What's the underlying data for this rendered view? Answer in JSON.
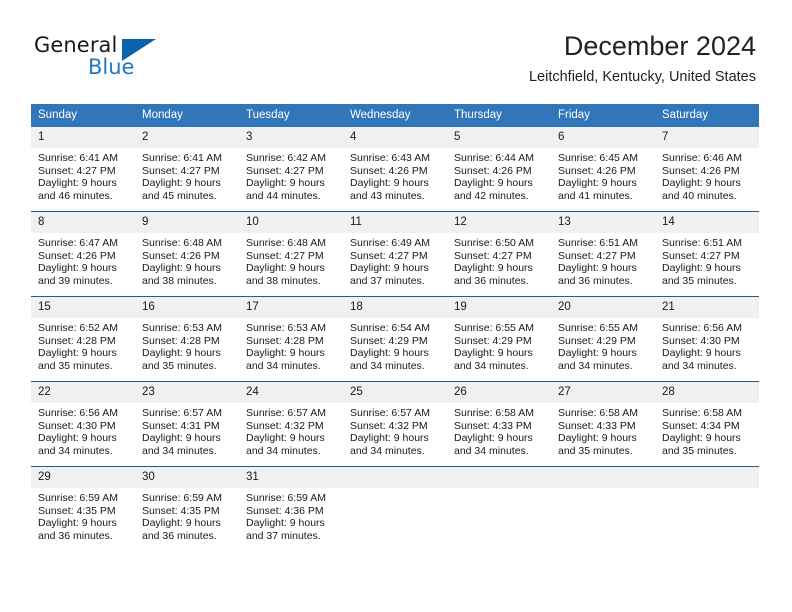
{
  "brand": {
    "name_top": "General",
    "name_bottom": "Blue",
    "accent_color": "#1f7ac4",
    "triangle_color": "#0c63ad"
  },
  "header": {
    "title": "December 2024",
    "subtitle": "Leitchfield, Kentucky, United States"
  },
  "theme": {
    "header_row_bg": "#3276ba",
    "daynum_bg": "#f0f0f0",
    "row_divider": "#1b5d9e",
    "text": "#1a1a1a"
  },
  "calendar": {
    "weekday_headers": [
      "Sunday",
      "Monday",
      "Tuesday",
      "Wednesday",
      "Thursday",
      "Friday",
      "Saturday"
    ],
    "weeks": [
      [
        {
          "day": "1",
          "sunrise": "Sunrise: 6:41 AM",
          "sunset": "Sunset: 4:27 PM",
          "daylight1": "Daylight: 9 hours",
          "daylight2": "and 46 minutes."
        },
        {
          "day": "2",
          "sunrise": "Sunrise: 6:41 AM",
          "sunset": "Sunset: 4:27 PM",
          "daylight1": "Daylight: 9 hours",
          "daylight2": "and 45 minutes."
        },
        {
          "day": "3",
          "sunrise": "Sunrise: 6:42 AM",
          "sunset": "Sunset: 4:27 PM",
          "daylight1": "Daylight: 9 hours",
          "daylight2": "and 44 minutes."
        },
        {
          "day": "4",
          "sunrise": "Sunrise: 6:43 AM",
          "sunset": "Sunset: 4:26 PM",
          "daylight1": "Daylight: 9 hours",
          "daylight2": "and 43 minutes."
        },
        {
          "day": "5",
          "sunrise": "Sunrise: 6:44 AM",
          "sunset": "Sunset: 4:26 PM",
          "daylight1": "Daylight: 9 hours",
          "daylight2": "and 42 minutes."
        },
        {
          "day": "6",
          "sunrise": "Sunrise: 6:45 AM",
          "sunset": "Sunset: 4:26 PM",
          "daylight1": "Daylight: 9 hours",
          "daylight2": "and 41 minutes."
        },
        {
          "day": "7",
          "sunrise": "Sunrise: 6:46 AM",
          "sunset": "Sunset: 4:26 PM",
          "daylight1": "Daylight: 9 hours",
          "daylight2": "and 40 minutes."
        }
      ],
      [
        {
          "day": "8",
          "sunrise": "Sunrise: 6:47 AM",
          "sunset": "Sunset: 4:26 PM",
          "daylight1": "Daylight: 9 hours",
          "daylight2": "and 39 minutes."
        },
        {
          "day": "9",
          "sunrise": "Sunrise: 6:48 AM",
          "sunset": "Sunset: 4:26 PM",
          "daylight1": "Daylight: 9 hours",
          "daylight2": "and 38 minutes."
        },
        {
          "day": "10",
          "sunrise": "Sunrise: 6:48 AM",
          "sunset": "Sunset: 4:27 PM",
          "daylight1": "Daylight: 9 hours",
          "daylight2": "and 38 minutes."
        },
        {
          "day": "11",
          "sunrise": "Sunrise: 6:49 AM",
          "sunset": "Sunset: 4:27 PM",
          "daylight1": "Daylight: 9 hours",
          "daylight2": "and 37 minutes."
        },
        {
          "day": "12",
          "sunrise": "Sunrise: 6:50 AM",
          "sunset": "Sunset: 4:27 PM",
          "daylight1": "Daylight: 9 hours",
          "daylight2": "and 36 minutes."
        },
        {
          "day": "13",
          "sunrise": "Sunrise: 6:51 AM",
          "sunset": "Sunset: 4:27 PM",
          "daylight1": "Daylight: 9 hours",
          "daylight2": "and 36 minutes."
        },
        {
          "day": "14",
          "sunrise": "Sunrise: 6:51 AM",
          "sunset": "Sunset: 4:27 PM",
          "daylight1": "Daylight: 9 hours",
          "daylight2": "and 35 minutes."
        }
      ],
      [
        {
          "day": "15",
          "sunrise": "Sunrise: 6:52 AM",
          "sunset": "Sunset: 4:28 PM",
          "daylight1": "Daylight: 9 hours",
          "daylight2": "and 35 minutes."
        },
        {
          "day": "16",
          "sunrise": "Sunrise: 6:53 AM",
          "sunset": "Sunset: 4:28 PM",
          "daylight1": "Daylight: 9 hours",
          "daylight2": "and 35 minutes."
        },
        {
          "day": "17",
          "sunrise": "Sunrise: 6:53 AM",
          "sunset": "Sunset: 4:28 PM",
          "daylight1": "Daylight: 9 hours",
          "daylight2": "and 34 minutes."
        },
        {
          "day": "18",
          "sunrise": "Sunrise: 6:54 AM",
          "sunset": "Sunset: 4:29 PM",
          "daylight1": "Daylight: 9 hours",
          "daylight2": "and 34 minutes."
        },
        {
          "day": "19",
          "sunrise": "Sunrise: 6:55 AM",
          "sunset": "Sunset: 4:29 PM",
          "daylight1": "Daylight: 9 hours",
          "daylight2": "and 34 minutes."
        },
        {
          "day": "20",
          "sunrise": "Sunrise: 6:55 AM",
          "sunset": "Sunset: 4:29 PM",
          "daylight1": "Daylight: 9 hours",
          "daylight2": "and 34 minutes."
        },
        {
          "day": "21",
          "sunrise": "Sunrise: 6:56 AM",
          "sunset": "Sunset: 4:30 PM",
          "daylight1": "Daylight: 9 hours",
          "daylight2": "and 34 minutes."
        }
      ],
      [
        {
          "day": "22",
          "sunrise": "Sunrise: 6:56 AM",
          "sunset": "Sunset: 4:30 PM",
          "daylight1": "Daylight: 9 hours",
          "daylight2": "and 34 minutes."
        },
        {
          "day": "23",
          "sunrise": "Sunrise: 6:57 AM",
          "sunset": "Sunset: 4:31 PM",
          "daylight1": "Daylight: 9 hours",
          "daylight2": "and 34 minutes."
        },
        {
          "day": "24",
          "sunrise": "Sunrise: 6:57 AM",
          "sunset": "Sunset: 4:32 PM",
          "daylight1": "Daylight: 9 hours",
          "daylight2": "and 34 minutes."
        },
        {
          "day": "25",
          "sunrise": "Sunrise: 6:57 AM",
          "sunset": "Sunset: 4:32 PM",
          "daylight1": "Daylight: 9 hours",
          "daylight2": "and 34 minutes."
        },
        {
          "day": "26",
          "sunrise": "Sunrise: 6:58 AM",
          "sunset": "Sunset: 4:33 PM",
          "daylight1": "Daylight: 9 hours",
          "daylight2": "and 34 minutes."
        },
        {
          "day": "27",
          "sunrise": "Sunrise: 6:58 AM",
          "sunset": "Sunset: 4:33 PM",
          "daylight1": "Daylight: 9 hours",
          "daylight2": "and 35 minutes."
        },
        {
          "day": "28",
          "sunrise": "Sunrise: 6:58 AM",
          "sunset": "Sunset: 4:34 PM",
          "daylight1": "Daylight: 9 hours",
          "daylight2": "and 35 minutes."
        }
      ],
      [
        {
          "day": "29",
          "sunrise": "Sunrise: 6:59 AM",
          "sunset": "Sunset: 4:35 PM",
          "daylight1": "Daylight: 9 hours",
          "daylight2": "and 36 minutes."
        },
        {
          "day": "30",
          "sunrise": "Sunrise: 6:59 AM",
          "sunset": "Sunset: 4:35 PM",
          "daylight1": "Daylight: 9 hours",
          "daylight2": "and 36 minutes."
        },
        {
          "day": "31",
          "sunrise": "Sunrise: 6:59 AM",
          "sunset": "Sunset: 4:36 PM",
          "daylight1": "Daylight: 9 hours",
          "daylight2": "and 37 minutes."
        },
        {
          "day": "",
          "sunrise": "",
          "sunset": "",
          "daylight1": "",
          "daylight2": ""
        },
        {
          "day": "",
          "sunrise": "",
          "sunset": "",
          "daylight1": "",
          "daylight2": ""
        },
        {
          "day": "",
          "sunrise": "",
          "sunset": "",
          "daylight1": "",
          "daylight2": ""
        },
        {
          "day": "",
          "sunrise": "",
          "sunset": "",
          "daylight1": "",
          "daylight2": ""
        }
      ]
    ]
  }
}
